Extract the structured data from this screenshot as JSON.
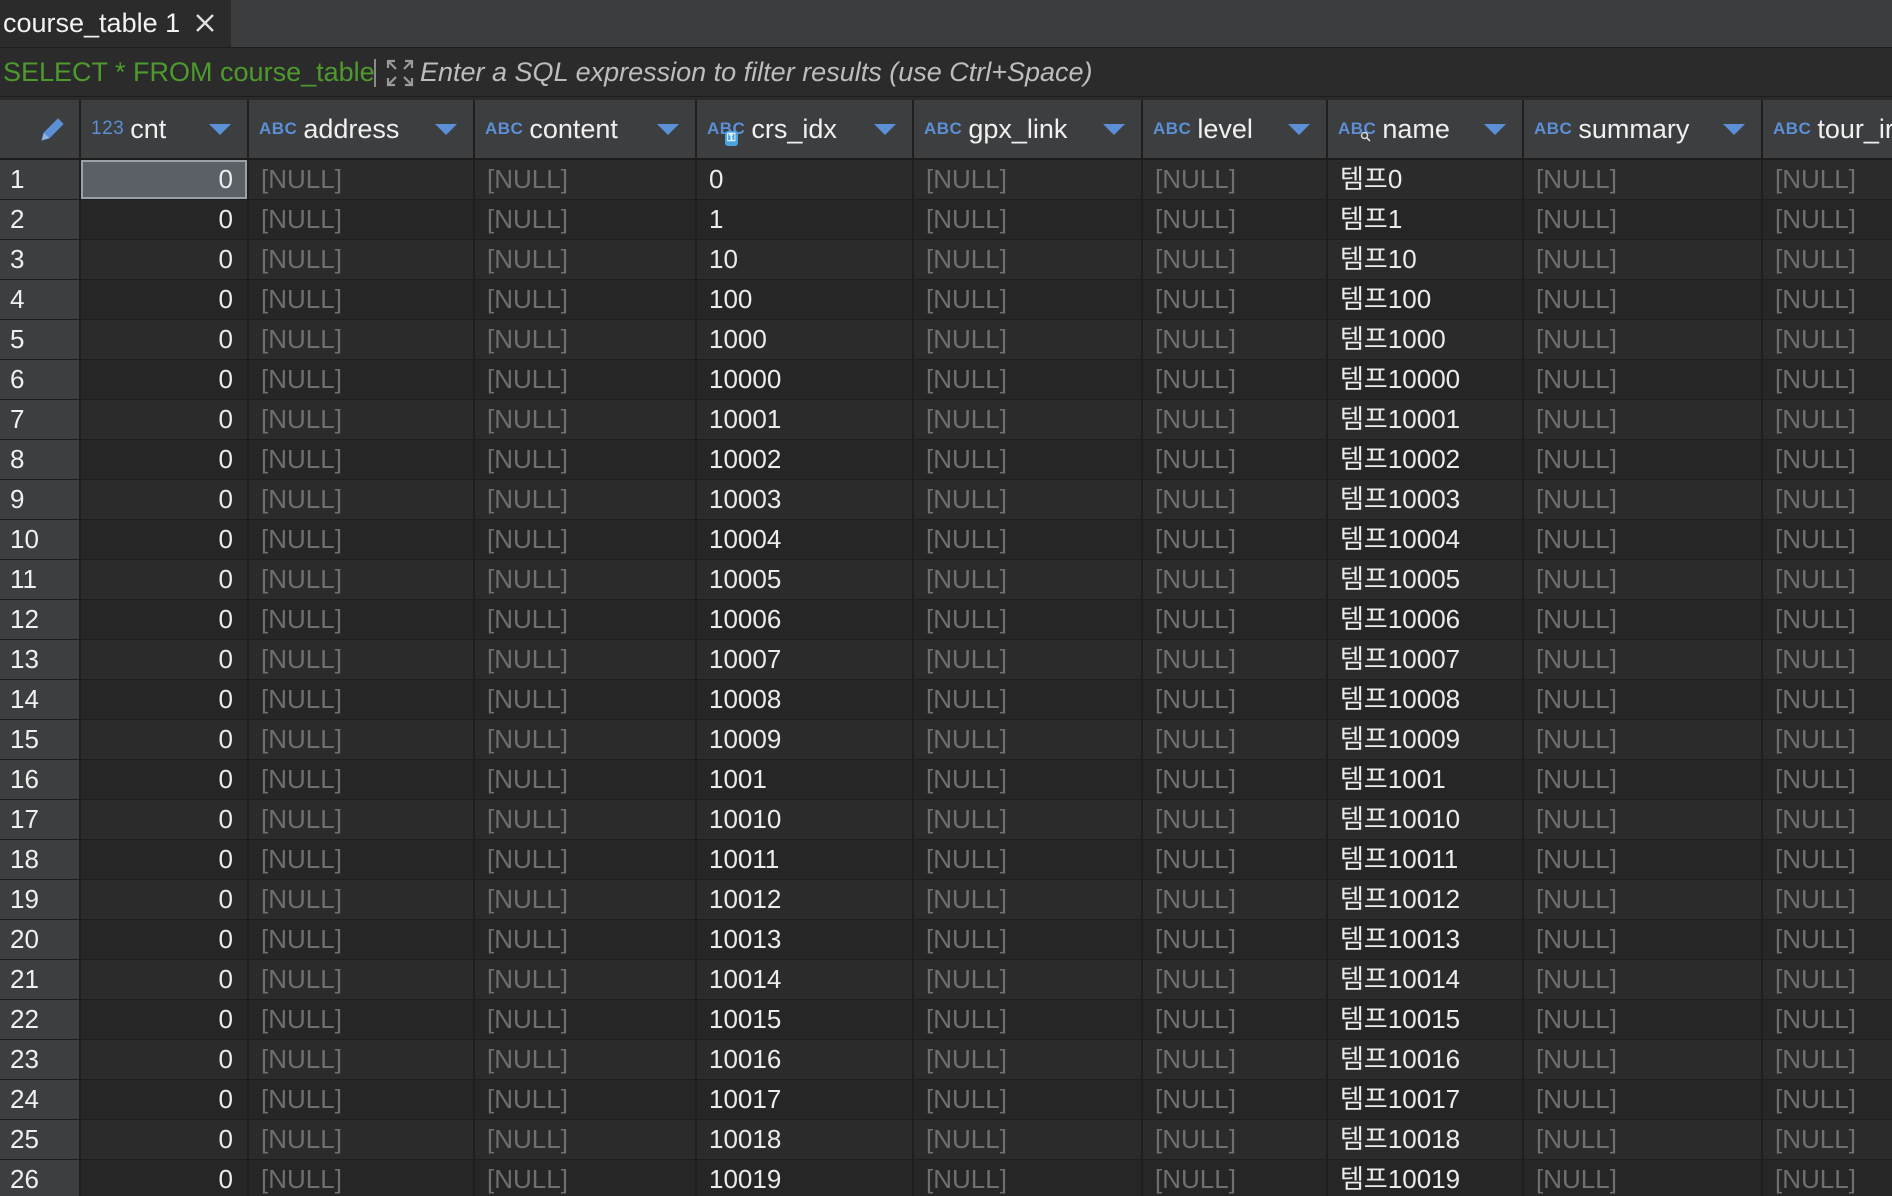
{
  "tab": {
    "label": "course_table 1"
  },
  "filter": {
    "query": "SELECT * FROM course_table",
    "placeholder": "Enter a SQL expression to filter results (use Ctrl+Space)"
  },
  "columns": [
    {
      "name": "cnt",
      "type": "123"
    },
    {
      "name": "address",
      "type": "ABC"
    },
    {
      "name": "content",
      "type": "ABC"
    },
    {
      "name": "crs_idx",
      "type": "ABC"
    },
    {
      "name": "gpx_link",
      "type": "ABC"
    },
    {
      "name": "level",
      "type": "ABC"
    },
    {
      "name": "name",
      "type": "ABC"
    },
    {
      "name": "summary",
      "type": "ABC"
    },
    {
      "name": "tour_ir",
      "type": "ABC"
    }
  ],
  "rows": [
    {
      "num": "1",
      "cnt": "0",
      "crs_idx": "0",
      "name": "템프0"
    },
    {
      "num": "2",
      "cnt": "0",
      "crs_idx": "1",
      "name": "템프1"
    },
    {
      "num": "3",
      "cnt": "0",
      "crs_idx": "10",
      "name": "템프10"
    },
    {
      "num": "4",
      "cnt": "0",
      "crs_idx": "100",
      "name": "템프100"
    },
    {
      "num": "5",
      "cnt": "0",
      "crs_idx": "1000",
      "name": "템프1000"
    },
    {
      "num": "6",
      "cnt": "0",
      "crs_idx": "10000",
      "name": "템프10000"
    },
    {
      "num": "7",
      "cnt": "0",
      "crs_idx": "10001",
      "name": "템프10001"
    },
    {
      "num": "8",
      "cnt": "0",
      "crs_idx": "10002",
      "name": "템프10002"
    },
    {
      "num": "9",
      "cnt": "0",
      "crs_idx": "10003",
      "name": "템프10003"
    },
    {
      "num": "10",
      "cnt": "0",
      "crs_idx": "10004",
      "name": "템프10004"
    },
    {
      "num": "11",
      "cnt": "0",
      "crs_idx": "10005",
      "name": "템프10005"
    },
    {
      "num": "12",
      "cnt": "0",
      "crs_idx": "10006",
      "name": "템프10006"
    },
    {
      "num": "13",
      "cnt": "0",
      "crs_idx": "10007",
      "name": "템프10007"
    },
    {
      "num": "14",
      "cnt": "0",
      "crs_idx": "10008",
      "name": "템프10008"
    },
    {
      "num": "15",
      "cnt": "0",
      "crs_idx": "10009",
      "name": "템프10009"
    },
    {
      "num": "16",
      "cnt": "0",
      "crs_idx": "1001",
      "name": "템프1001"
    },
    {
      "num": "17",
      "cnt": "0",
      "crs_idx": "10010",
      "name": "템프10010"
    },
    {
      "num": "18",
      "cnt": "0",
      "crs_idx": "10011",
      "name": "템프10011"
    },
    {
      "num": "19",
      "cnt": "0",
      "crs_idx": "10012",
      "name": "템프10012"
    },
    {
      "num": "20",
      "cnt": "0",
      "crs_idx": "10013",
      "name": "템프10013"
    },
    {
      "num": "21",
      "cnt": "0",
      "crs_idx": "10014",
      "name": "템프10014"
    },
    {
      "num": "22",
      "cnt": "0",
      "crs_idx": "10015",
      "name": "템프10015"
    },
    {
      "num": "23",
      "cnt": "0",
      "crs_idx": "10016",
      "name": "템프10016"
    },
    {
      "num": "24",
      "cnt": "0",
      "crs_idx": "10017",
      "name": "템프10017"
    },
    {
      "num": "25",
      "cnt": "0",
      "crs_idx": "10018",
      "name": "템프10018"
    },
    {
      "num": "26",
      "cnt": "0",
      "crs_idx": "10019",
      "name": "템프10019"
    }
  ],
  "null_text": "[NULL]",
  "selected_row": 1,
  "colors": {
    "accent": "#5b8fd6",
    "query": "#4e9a2e",
    "null": "#6f6f70"
  }
}
